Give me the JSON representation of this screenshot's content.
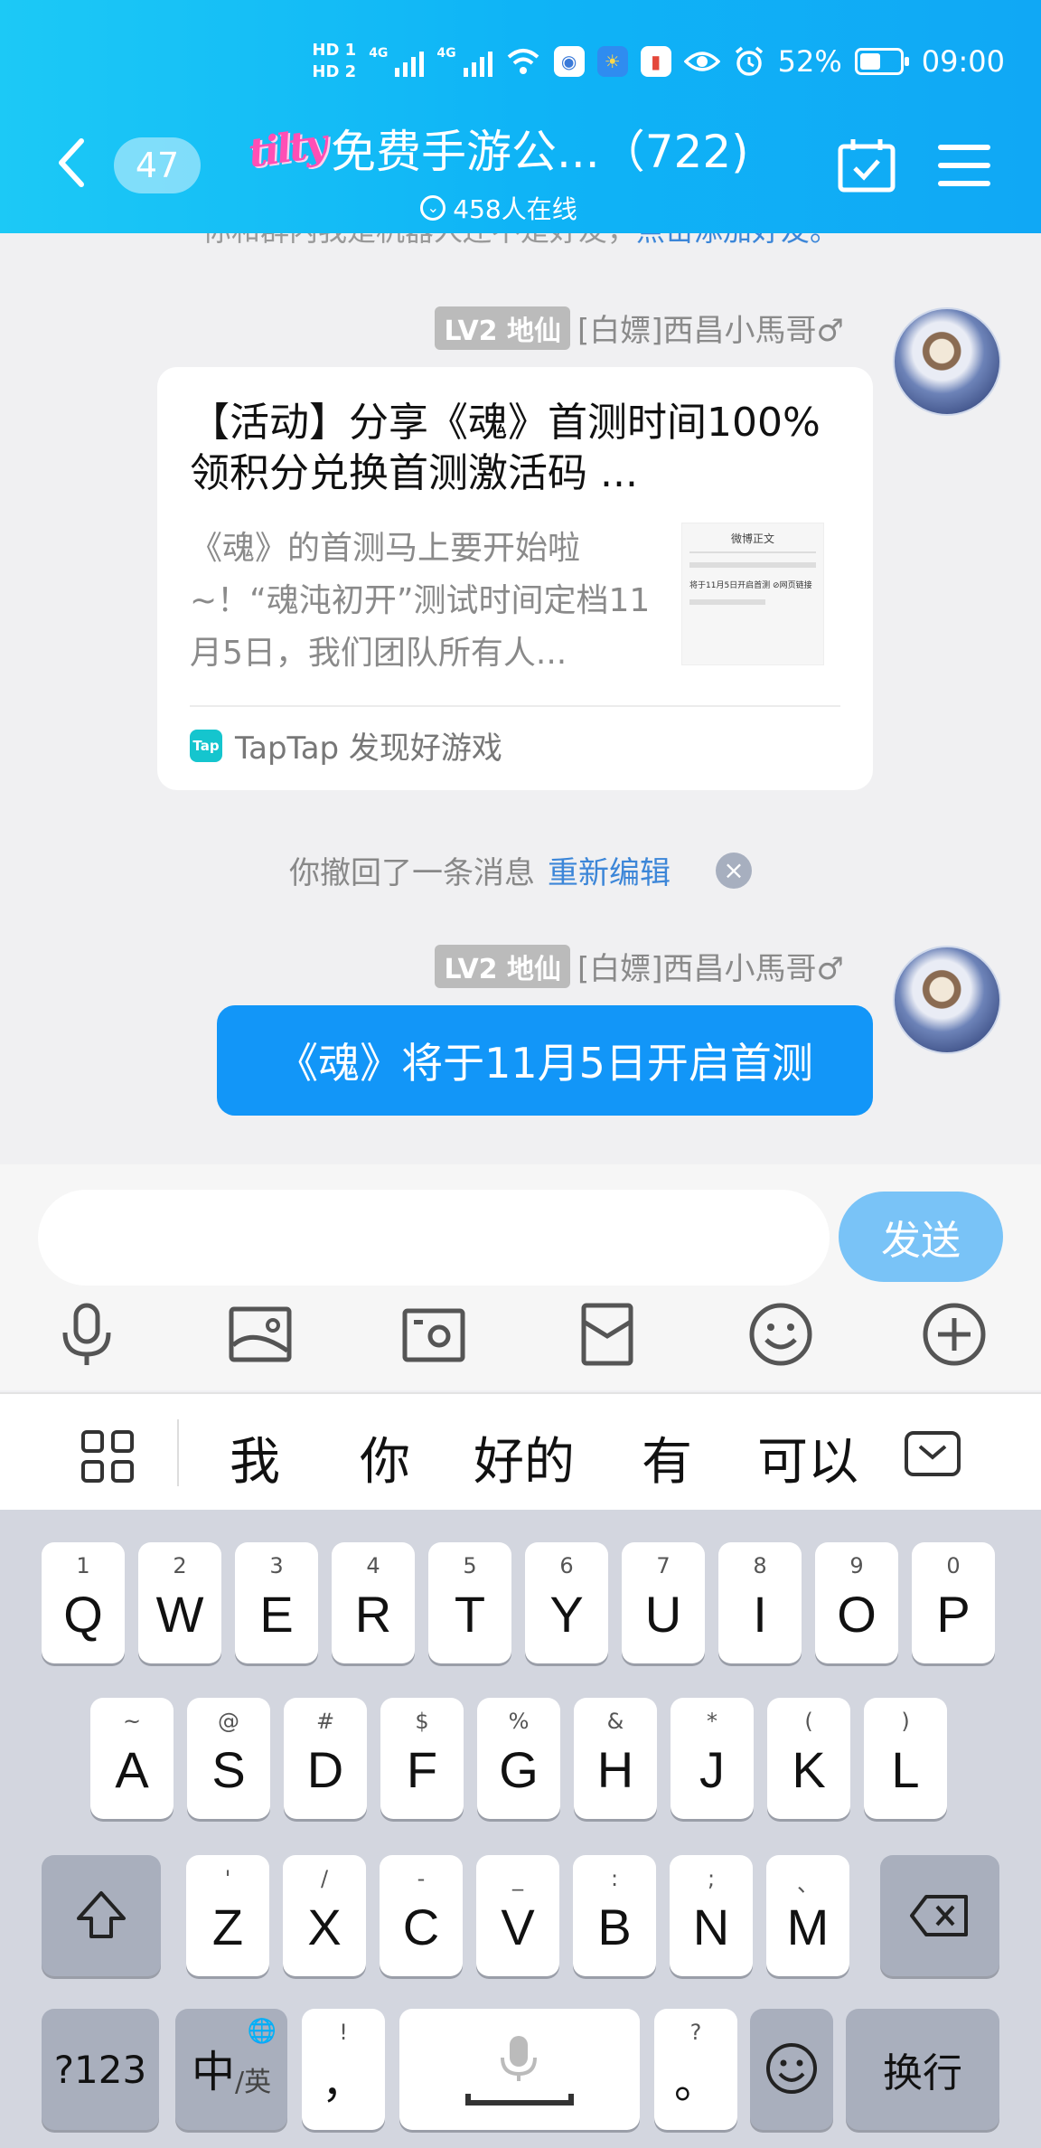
{
  "status": {
    "hd1": "HD 1",
    "hd2": "HD 2",
    "net1": "4G",
    "net2": "4G",
    "battery_pct": 52,
    "battery_text": "52%",
    "time": "09:00"
  },
  "header": {
    "back_count": "47",
    "logo_text": "tilty",
    "title": "免费手游公...（722)",
    "online": "458人在线"
  },
  "chat": {
    "hidden_tip_prefix": "你和群内我是机器人还不是好友，",
    "hidden_tip_link": "点击添加好友。",
    "messages": [
      {
        "level": "LV2 地仙",
        "sender": "[白嫖]西昌小馬哥♂",
        "card": {
          "title": "【活动】分享《魂》首测时间100%领积分兑换首测激活码 ...",
          "desc": "《魂》的首测马上要开始啦~！“魂沌初开”测试时间定档11月5日，我们团队所有人...",
          "thumb_header": "微博正文",
          "thumb_text": "将于11月5日开启首测 ⊘网页链接",
          "source_icon": "Tap",
          "source": "TapTap 发现好游戏"
        }
      },
      {
        "level": "LV2 地仙",
        "sender": "[白嫖]西昌小馬哥♂",
        "text": "《魂》将于11月5日开启首测"
      }
    ],
    "recall_text": "你撤回了一条消息",
    "recall_edit": "重新编辑",
    "recall_close": "×"
  },
  "composer": {
    "placeholder": "",
    "send_label": "发送",
    "tools": [
      "microphone-icon",
      "image-icon",
      "camera-icon",
      "red-packet-icon",
      "emoji-icon",
      "plus-icon"
    ]
  },
  "ime": {
    "candidates": [
      "我",
      "你",
      "好的",
      "有",
      "可以"
    ]
  },
  "keyboard": {
    "row1": [
      {
        "main": "Q",
        "sub": "1"
      },
      {
        "main": "W",
        "sub": "2"
      },
      {
        "main": "E",
        "sub": "3"
      },
      {
        "main": "R",
        "sub": "4"
      },
      {
        "main": "T",
        "sub": "5"
      },
      {
        "main": "Y",
        "sub": "6"
      },
      {
        "main": "U",
        "sub": "7"
      },
      {
        "main": "I",
        "sub": "8"
      },
      {
        "main": "O",
        "sub": "9"
      },
      {
        "main": "P",
        "sub": "0"
      }
    ],
    "row2": [
      {
        "main": "A",
        "sub": "~"
      },
      {
        "main": "S",
        "sub": "@"
      },
      {
        "main": "D",
        "sub": "#"
      },
      {
        "main": "F",
        "sub": "$"
      },
      {
        "main": "G",
        "sub": "%"
      },
      {
        "main": "H",
        "sub": "&"
      },
      {
        "main": "J",
        "sub": "*"
      },
      {
        "main": "K",
        "sub": "("
      },
      {
        "main": "L",
        "sub": ")"
      }
    ],
    "row3": [
      {
        "main": "Z",
        "sub": "'"
      },
      {
        "main": "X",
        "sub": "/"
      },
      {
        "main": "C",
        "sub": "-"
      },
      {
        "main": "V",
        "sub": "_"
      },
      {
        "main": "B",
        "sub": ":"
      },
      {
        "main": "N",
        "sub": ";"
      },
      {
        "main": "M",
        "sub": "、"
      }
    ],
    "sym_label": "?123",
    "lang_main": "中",
    "lang_sub": "/英",
    "comma_main": "，",
    "comma_sub": "!",
    "period_main": "。",
    "period_sub": "?",
    "enter_label": "换行"
  }
}
